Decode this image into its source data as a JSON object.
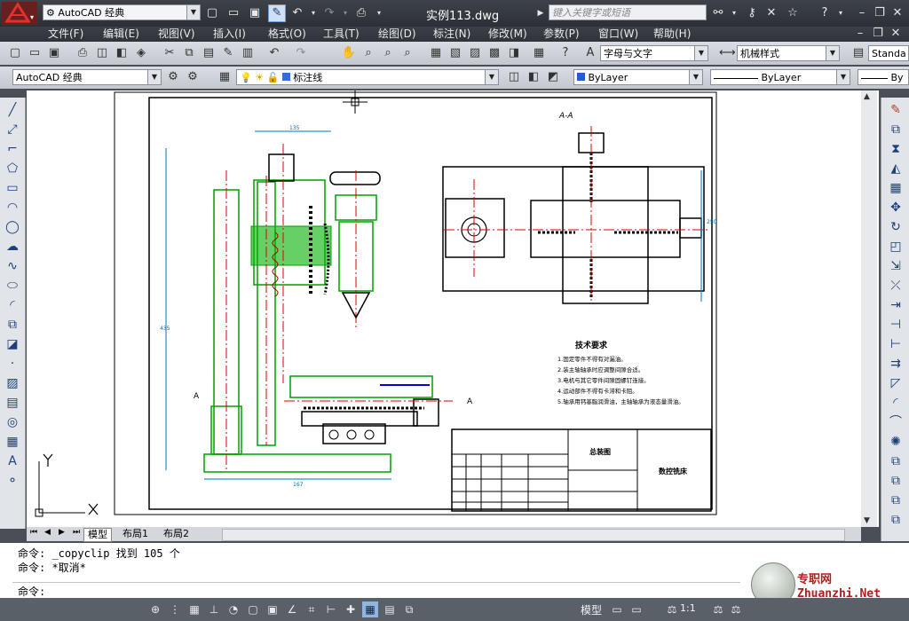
{
  "title_bar": {
    "workspace": "AutoCAD 经典",
    "document_title": "实例113.dwg",
    "search_placeholder": "键入关键字或短语"
  },
  "menu": [
    "文件(F)",
    "编辑(E)",
    "视图(V)",
    "插入(I)",
    "格式(O)",
    "工具(T)",
    "绘图(D)",
    "标注(N)",
    "修改(M)",
    "参数(P)",
    "窗口(W)",
    "帮助(H)"
  ],
  "toolbar1": {
    "text_style": "字母与文字",
    "dim_style": "机械样式",
    "table_style": "Standa"
  },
  "toolbar2": {
    "workspace": "AutoCAD 经典",
    "layer": "标注线",
    "color": "ByLayer",
    "linetype": "ByLayer",
    "lineweight": "By"
  },
  "drawing": {
    "section_label": "A-A",
    "dim_top": "135",
    "dim_side": "435",
    "dim_right": "250",
    "dim_bottom": "167",
    "tech_title": "技术要求",
    "tech_notes": [
      "1.固定零件不得有对漏油。",
      "2.装主轴轴承时应调整间隙合适。",
      "3.电机与其它零件间隙固螺钉连接。",
      "4.运动部件不得有卡滞和卡阻。",
      "5.轴承用钙基脂润滑油，主轴轴承为液态量滑油。"
    ],
    "block_title": "总装图",
    "block_name": "数控铣床",
    "section_marker": "A"
  },
  "layout_tabs": [
    "模型",
    "布局1",
    "布局2"
  ],
  "command": {
    "line1": "命令: _copyclip 找到 105 个",
    "line2": "命令: *取消*",
    "prompt": "命令:"
  },
  "status": {
    "model_label": "模型",
    "scale": "1:1"
  },
  "watermark": "专职网 Zhuanzhi.Net"
}
